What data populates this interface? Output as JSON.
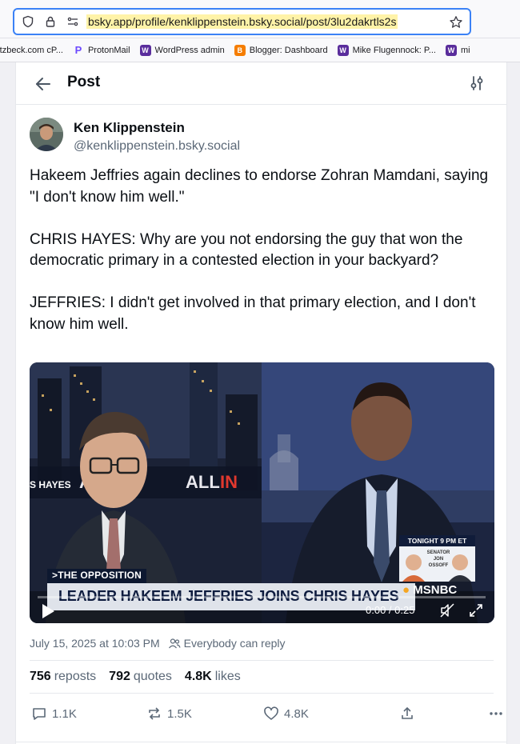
{
  "browser": {
    "url": "bsky.app/profile/kenklippenstein.bsky.social/post/3lu2dakrtls2s",
    "bookmarks": [
      {
        "label": "rtzbeck.com cP...",
        "icon": "cpanel-icon",
        "color": ""
      },
      {
        "label": "ProtonMail",
        "icon": "protonmail-icon",
        "color": "#6d4aff"
      },
      {
        "label": "WordPress admin",
        "icon": "wordpress-icon",
        "color": "#5a2d9c"
      },
      {
        "label": "Blogger: Dashboard",
        "icon": "blogger-icon",
        "color": "#f57d00"
      },
      {
        "label": "Mike Flugennock: P...",
        "icon": "wordpress-icon",
        "color": "#5a2d9c"
      },
      {
        "label": "mi",
        "icon": "wordpress-icon",
        "color": "#5a2d9c"
      }
    ]
  },
  "header": {
    "title": "Post"
  },
  "post": {
    "author_name": "Ken Klippenstein",
    "author_handle": "@kenklippenstein.bsky.social",
    "paragraphs": [
      "Hakeem Jeffries again declines to endorse Zohran Mamdani, saying \"I don't know him well.\"",
      "CHRIS HAYES: Why are you not endorsing the guy that won the democratic primary in a contested election in your backyard?",
      "JEFFRIES: I didn't get involved in that primary election, and I don't know him well."
    ],
    "video": {
      "chyron_small": ">THE OPPOSITION",
      "chyron_big": "LEADER HAKEEM JEFFRIES JOINS CHRIS HAYES",
      "network": "MSNBC",
      "tonight": "TONIGHT 9 PM ET",
      "tonight_sub": "SENATOR JON OSSOFF",
      "hayes_tag": "S HAYES",
      "time": "0:00 / 0:25",
      "progress": 0
    },
    "timestamp": "July 15, 2025 at 10:03 PM",
    "reply_setting": "Everybody can reply",
    "stats": {
      "reposts_count": "756",
      "reposts_label": "reposts",
      "quotes_count": "792",
      "quotes_label": "quotes",
      "likes_count": "4.8K",
      "likes_label": "likes"
    },
    "actions": {
      "replies": "1.1K",
      "reposts": "1.5K",
      "likes": "4.8K"
    }
  }
}
